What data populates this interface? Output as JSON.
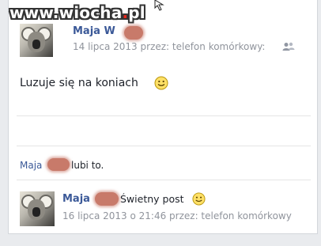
{
  "watermark": {
    "prefix": "www.",
    "brand": "wiocha",
    "dot": ".",
    "tld": "pl"
  },
  "post": {
    "author": "Maja W",
    "date": "14 lipca 2013",
    "via": "przez: telefon komórkowy:",
    "audience_icon": "friends-icon",
    "text": "Luzuje się na koniach",
    "emoji": "smiley"
  },
  "likes": {
    "name": "Maja",
    "suffix": "lubi to."
  },
  "comment": {
    "author": "Maja",
    "text": "Świetny post",
    "emoji": "smiley",
    "meta": "16 lipca 2013 o 21:46 przez: telefon komórkowy"
  },
  "colors": {
    "link": "#3b5998",
    "meta": "#90949c",
    "redaction": "#c87a6a",
    "background": "#e9ebee"
  }
}
